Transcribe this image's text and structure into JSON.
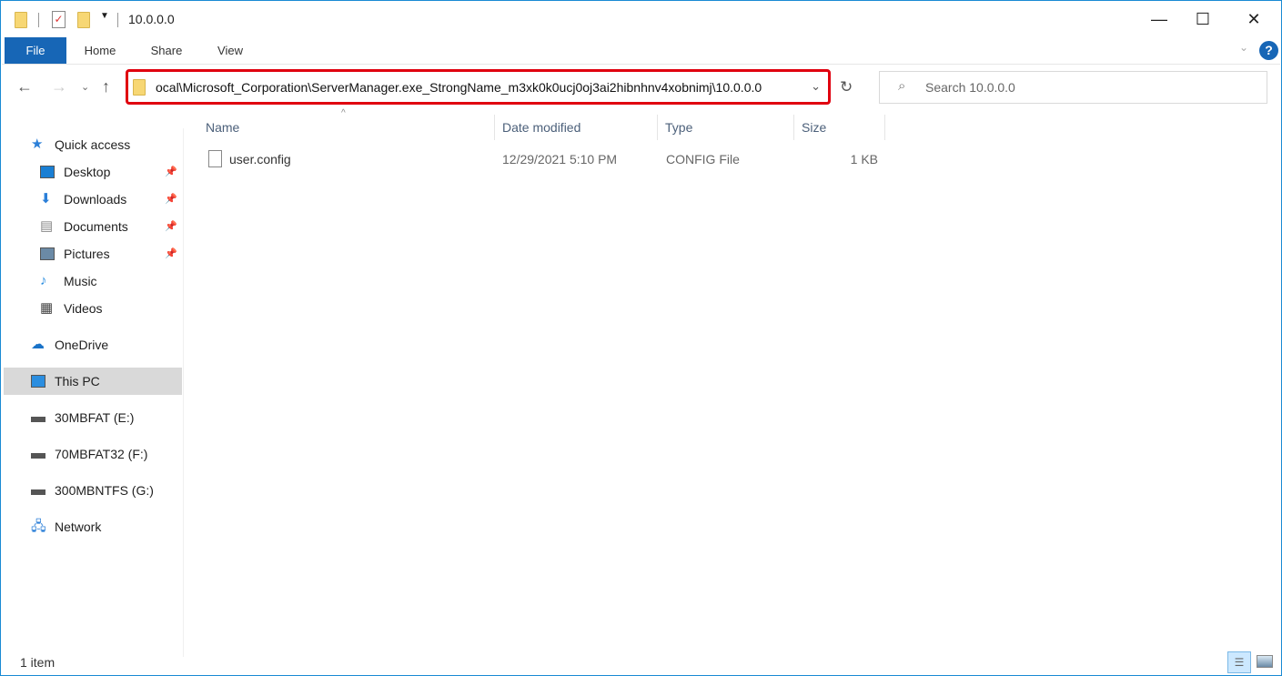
{
  "window": {
    "title": "10.0.0.0",
    "minimize": "—",
    "maximize": "☐",
    "close": "✕"
  },
  "ribbon": {
    "tabs": [
      "File",
      "Home",
      "Share",
      "View"
    ],
    "help": "?"
  },
  "address": {
    "path": "ocal\\Microsoft_Corporation\\ServerManager.exe_StrongName_m3xk0k0ucj0oj3ai2hibnhnv4xobnimj\\10.0.0.0",
    "highlight_color": "#e0000f"
  },
  "search": {
    "placeholder": "Search 10.0.0.0"
  },
  "sidebar": {
    "items": [
      {
        "label": "Quick access",
        "icon": "star-icon"
      },
      {
        "label": "Desktop",
        "icon": "desktop-icon",
        "pinned": true
      },
      {
        "label": "Downloads",
        "icon": "download-icon",
        "pinned": true
      },
      {
        "label": "Documents",
        "icon": "document-icon",
        "pinned": true
      },
      {
        "label": "Pictures",
        "icon": "picture-icon",
        "pinned": true
      },
      {
        "label": "Music",
        "icon": "music-icon"
      },
      {
        "label": "Videos",
        "icon": "video-icon"
      },
      {
        "label": "OneDrive",
        "icon": "cloud-icon"
      },
      {
        "label": "This PC",
        "icon": "computer-icon",
        "selected": true
      },
      {
        "label": "30MBFAT (E:)",
        "icon": "drive-icon"
      },
      {
        "label": "70MBFAT32 (F:)",
        "icon": "drive-icon"
      },
      {
        "label": "300MBNTFS (G:)",
        "icon": "drive-icon"
      },
      {
        "label": "Network",
        "icon": "network-icon"
      }
    ]
  },
  "columns": [
    "Name",
    "Date modified",
    "Type",
    "Size"
  ],
  "files": [
    {
      "name": "user.config",
      "date": "12/29/2021 5:10 PM",
      "type": "CONFIG File",
      "size": "1 KB"
    }
  ],
  "status": {
    "count": "1 item"
  }
}
